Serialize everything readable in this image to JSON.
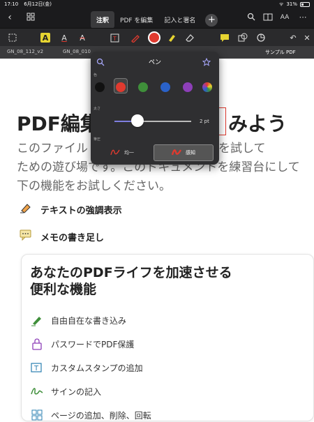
{
  "status": {
    "time": "17:10",
    "date": "6月12日(金)",
    "battery": "31%"
  },
  "topbar": {
    "tabs": [
      {
        "label": "注釈"
      },
      {
        "label": "PDF を編集"
      },
      {
        "label": "記入と署名"
      }
    ],
    "font_label": "AA"
  },
  "doc_tabs": [
    "GN_08_112_v2",
    "GN_08_010",
    "サンプル PDF"
  ],
  "pen_popup": {
    "title": "ペン",
    "color_label": "色",
    "size_label": "太さ",
    "pressure_label": "筆圧",
    "size_value": "2 pt",
    "size_fraction": 0.22,
    "mode_uniform": "均一",
    "mode_sensitive": "感知",
    "colors": [
      "#111111",
      "#e03a2f",
      "#3f8f3a",
      "#2a62c9",
      "#8d3fb8",
      "rainbow"
    ],
    "selected_color": "#e03a2f"
  },
  "page": {
    "heading_left": "PDF編集",
    "heading_right": "みよう",
    "paragraph_lines": [
      "このファイル　　　　　　　編集機能を試して",
      "ための遊び場です。このドキュメントを練習台にして",
      "下の機能をお試しください。"
    ],
    "features": [
      "テキストの強調表示",
      "メモの書き足し"
    ],
    "card_title_1": "あなたのPDFライフを加速させる",
    "card_title_2": "便利な機能",
    "card_items": [
      "自由自在な書き込み",
      "パスワードでPDF保護",
      "カスタムスタンプの追加",
      "サインの記入",
      "ページの追加、削除、回転"
    ]
  }
}
